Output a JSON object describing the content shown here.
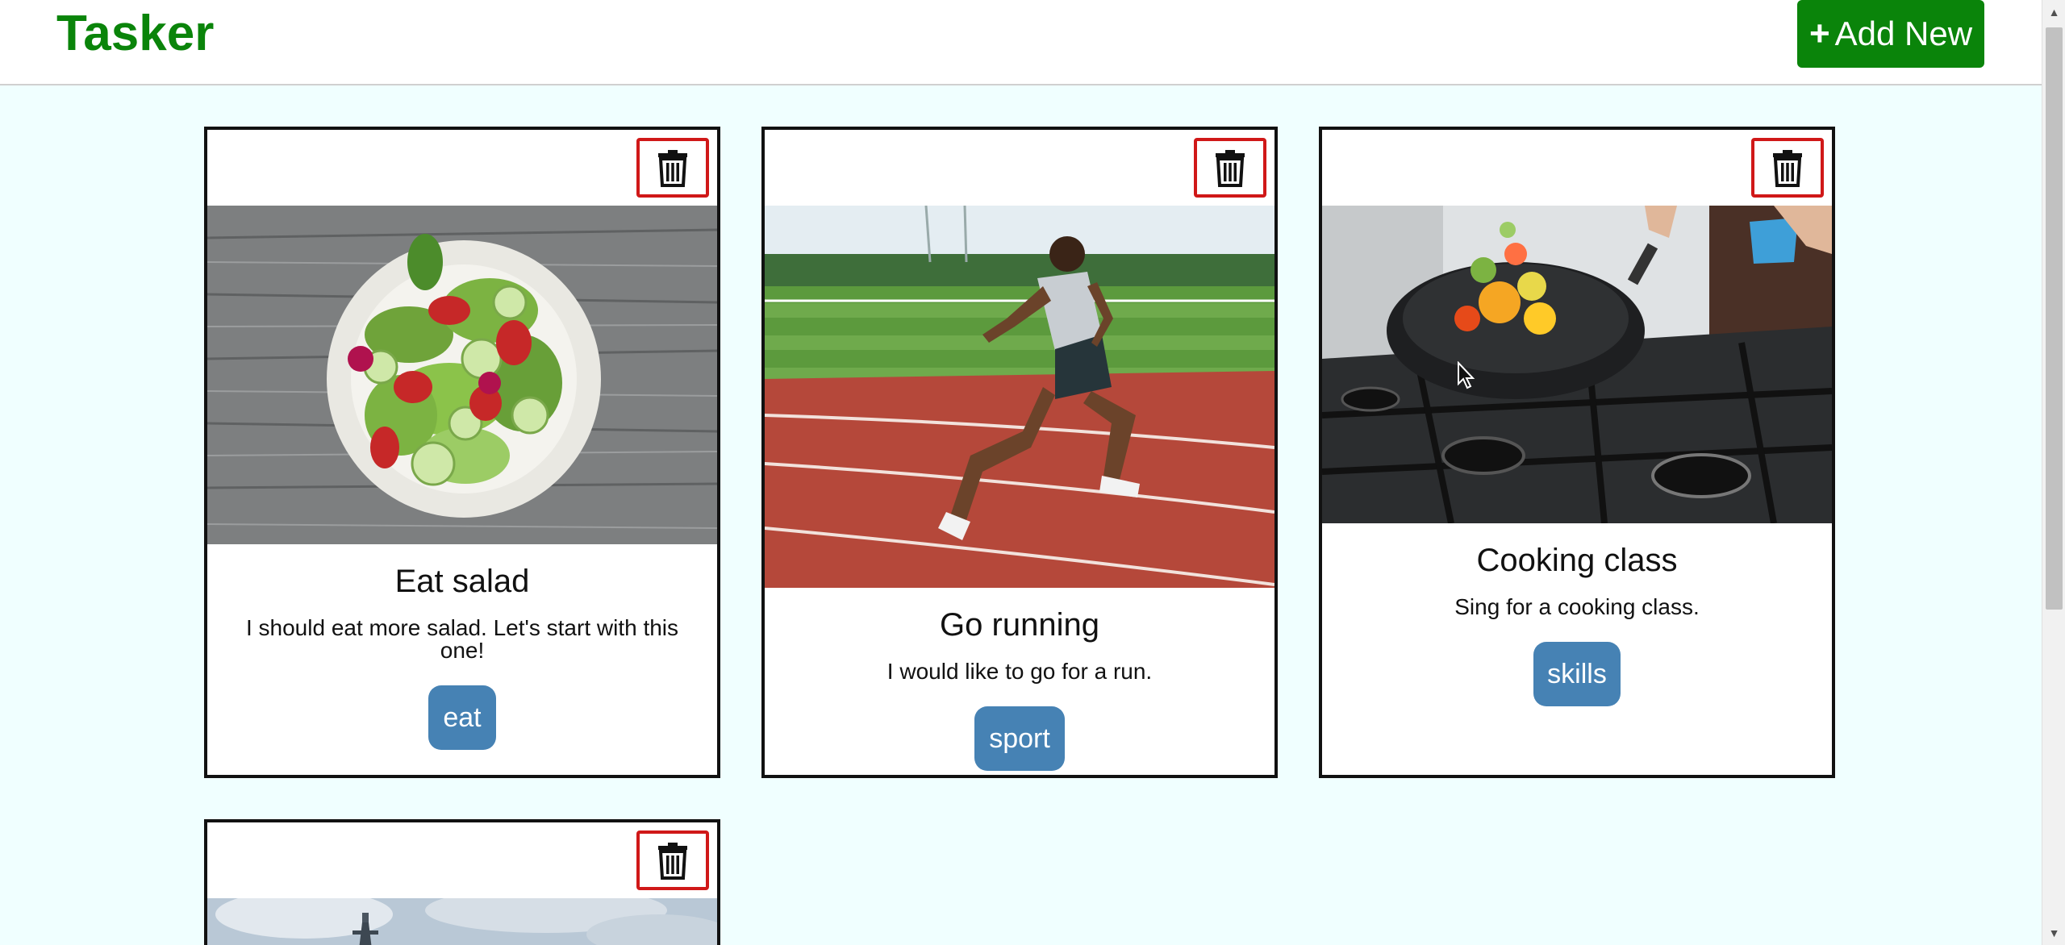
{
  "app": {
    "title": "Tasker"
  },
  "toolbar": {
    "add_plus": "+",
    "add_label": "Add New"
  },
  "colors": {
    "brand": "#0a840a",
    "tag": "#4682b4",
    "delete_border": "#d01818",
    "background": "#f0ffff"
  },
  "cards": [
    {
      "title": "Eat salad",
      "description": "I should eat more salad. Let's start with this one!",
      "tag": "eat",
      "image": "salad-bowl-photo",
      "delete_icon": "trash-icon"
    },
    {
      "title": "Go running",
      "description": "I would like to go for a run.",
      "tag": "sport",
      "image": "runner-on-track-photo",
      "delete_icon": "trash-icon"
    },
    {
      "title": "Cooking class",
      "description": "Sing for a cooking class.",
      "tag": "skills",
      "image": "pan-on-stove-photo",
      "delete_icon": "trash-icon"
    },
    {
      "title": "",
      "description": "",
      "tag": "",
      "image": "eiffel-tower-photo",
      "delete_icon": "trash-icon"
    }
  ]
}
